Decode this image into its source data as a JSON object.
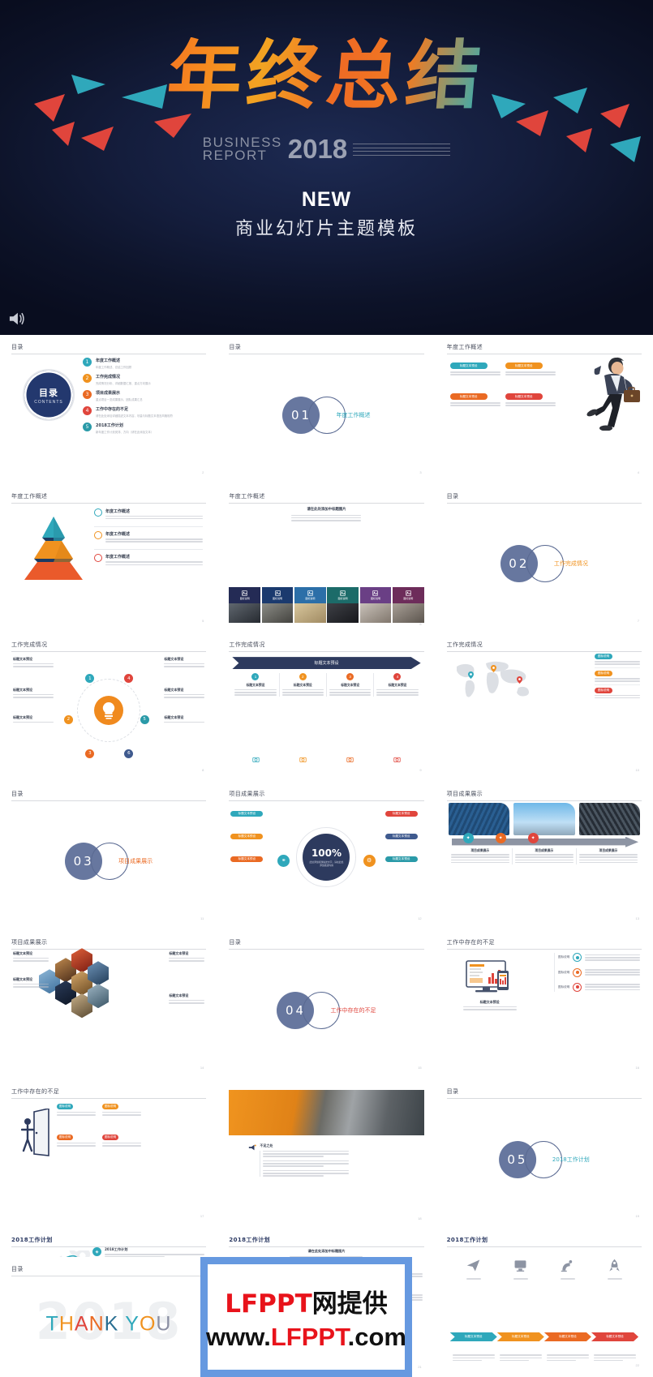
{
  "cover": {
    "title_cn": "年终总结",
    "brand_line1": "BUSINESS",
    "brand_line2": "REPORT",
    "year": "2018",
    "new_label": "NEW",
    "subtitle_cn": "商业幻灯片主题模板",
    "speaker_icon": "speaker-icon"
  },
  "colors": {
    "teal": "#2fa8bb",
    "orange": "#f0921f",
    "deep_orange": "#ea6a23",
    "red": "#e0453c",
    "navy": "#2d3a5e",
    "slate": "#67779f",
    "watermark_frame": "#6699e0",
    "watermark_red": "#e8131b"
  },
  "toc": {
    "header": "目录",
    "ring_title": "目录",
    "ring_sub": "CONTENTS",
    "items": [
      {
        "num": "1",
        "title": "年度工作概述",
        "sub": "年度工作概述、总结工作回顾",
        "color": "#2fa8bb"
      },
      {
        "num": "2",
        "title": "工作完成情况",
        "sub": "完成情况分析、详细数据汇报、重点方向展示",
        "color": "#f0921f"
      },
      {
        "num": "3",
        "title": "项目成果展示",
        "sub": "重点项目一览成果展示、团队成果汇总",
        "color": "#ea6a23"
      },
      {
        "num": "4",
        "title": "工作中存在的不足",
        "sub": "请在此处添加详细描述文本内容，尽量与标题文本语言风格相符",
        "color": "#e0453c"
      },
      {
        "num": "5",
        "title": "2018工作计划",
        "sub": "新年度工作计划安排、方向（请在此添加文本）",
        "color": "#2a9aa8"
      }
    ]
  },
  "sections": [
    {
      "num": "01",
      "label": "年度工作概述"
    },
    {
      "num": "02",
      "label": "工作完成情况"
    },
    {
      "num": "03",
      "label": "项目成果展示"
    },
    {
      "num": "04",
      "label": "工作中存在的不足"
    },
    {
      "num": "05",
      "label": "2018工作计划"
    }
  ],
  "titles": {
    "toc": "目录",
    "annual": "年度工作概述",
    "completion": "工作完成情况",
    "achievements": "项目成果展示",
    "shortfalls": "工作中存在的不足",
    "plan2018": "2018工作计划"
  },
  "placeholders": {
    "pill_title": "标题文本预设",
    "body_1": "此部分内容作为文字排版占位显示（建议使用主题字体）",
    "body_2": "如需更改请在（设置）和（文本）中编辑，建议不要超过一行文字",
    "sub_head": "请在此处添加中标题图片",
    "result_head": "项目成果展示",
    "icon_label": "图标说明",
    "shortfall_label": "不足之处",
    "lightbulb_label": "标题文本预设",
    "hundred": "100%",
    "hundred_sub": "此处添加标题描述文字，请在此处添加描述内容"
  },
  "grid_slides": [
    {
      "id": "toc-overview",
      "title": "目录",
      "type": "toc",
      "page": "2"
    },
    {
      "id": "section-01",
      "title": "目录",
      "type": "section",
      "section": 0,
      "page": "3"
    },
    {
      "id": "annual-4pill",
      "title": "年度工作概述",
      "type": "four-pill",
      "page": "4"
    },
    {
      "id": "annual-pyramid",
      "title": "年度工作概述",
      "type": "pyramid",
      "page": "5"
    },
    {
      "id": "annual-photostrip",
      "title": "年度工作概述",
      "type": "photostrip",
      "page": "6"
    },
    {
      "id": "section-02",
      "title": "目录",
      "type": "section",
      "section": 1,
      "page": "7"
    },
    {
      "id": "completion-bulb",
      "title": "工作完成情况",
      "type": "bulb",
      "page": "8"
    },
    {
      "id": "completion-banner",
      "title": "工作完成情况",
      "type": "banner",
      "page": "9"
    },
    {
      "id": "completion-map",
      "title": "工作完成情况",
      "type": "map",
      "page": "10"
    },
    {
      "id": "section-03",
      "title": "目录",
      "type": "section",
      "section": 2,
      "page": "11"
    },
    {
      "id": "results-donut",
      "title": "项目成果展示",
      "type": "donut",
      "page": "12"
    },
    {
      "id": "results-buildings",
      "title": "项目成果展示",
      "type": "buildings",
      "page": "13"
    },
    {
      "id": "results-hexagons",
      "title": "项目成果展示",
      "type": "hexagons",
      "page": "14"
    },
    {
      "id": "section-04",
      "title": "目录",
      "type": "section",
      "section": 3,
      "page": "15"
    },
    {
      "id": "short-monitor",
      "title": "工作中存在的不足",
      "type": "monitor",
      "page": "16"
    },
    {
      "id": "short-door",
      "title": "工作中存在的不足",
      "type": "door",
      "page": "17"
    },
    {
      "id": "short-photo",
      "title": "",
      "type": "bigphoto",
      "page": "18"
    },
    {
      "id": "section-05",
      "title": "目录",
      "type": "section",
      "section": 4,
      "page": "19"
    },
    {
      "id": "plan-orbits",
      "title": "2018工作计划",
      "type": "orbits",
      "page": "20"
    },
    {
      "id": "plan-people",
      "title": "2018工作计划",
      "type": "people",
      "page": "21"
    },
    {
      "id": "plan-chevrons",
      "title": "2018工作计划",
      "type": "chevrons",
      "page": "22"
    },
    {
      "id": "thankyou",
      "title": "目录",
      "type": "thankyou",
      "page": "23"
    }
  ],
  "plan_items": [
    {
      "title": "2018工作计划",
      "color": "#2fa8bb"
    },
    {
      "title": "2018工作计划",
      "color": "#f0921f"
    },
    {
      "title": "2018工作计划",
      "color": "#ea6a23"
    },
    {
      "title": "2018工作计划",
      "color": "#e0453c"
    }
  ],
  "thankyou": {
    "bg_year": "2018",
    "letters": [
      {
        "c": "T",
        "color": "#2fa8bb"
      },
      {
        "c": "H",
        "color": "#f0921f"
      },
      {
        "c": "A",
        "color": "#e0453c"
      },
      {
        "c": "N",
        "color": "#ea6a23"
      },
      {
        "c": "K",
        "color": "#2a6f92"
      },
      {
        "c": " ",
        "color": "#ffffff"
      },
      {
        "c": "Y",
        "color": "#2fa8bb"
      },
      {
        "c": "O",
        "color": "#f0921f"
      },
      {
        "c": "U",
        "color": "#8b8fa3"
      }
    ]
  },
  "watermark": {
    "line1_red": "LFPPT",
    "line1_black": "网提供",
    "line2_pre": "www.",
    "line2_red": "LFPPT",
    "line2_post": ".com"
  }
}
